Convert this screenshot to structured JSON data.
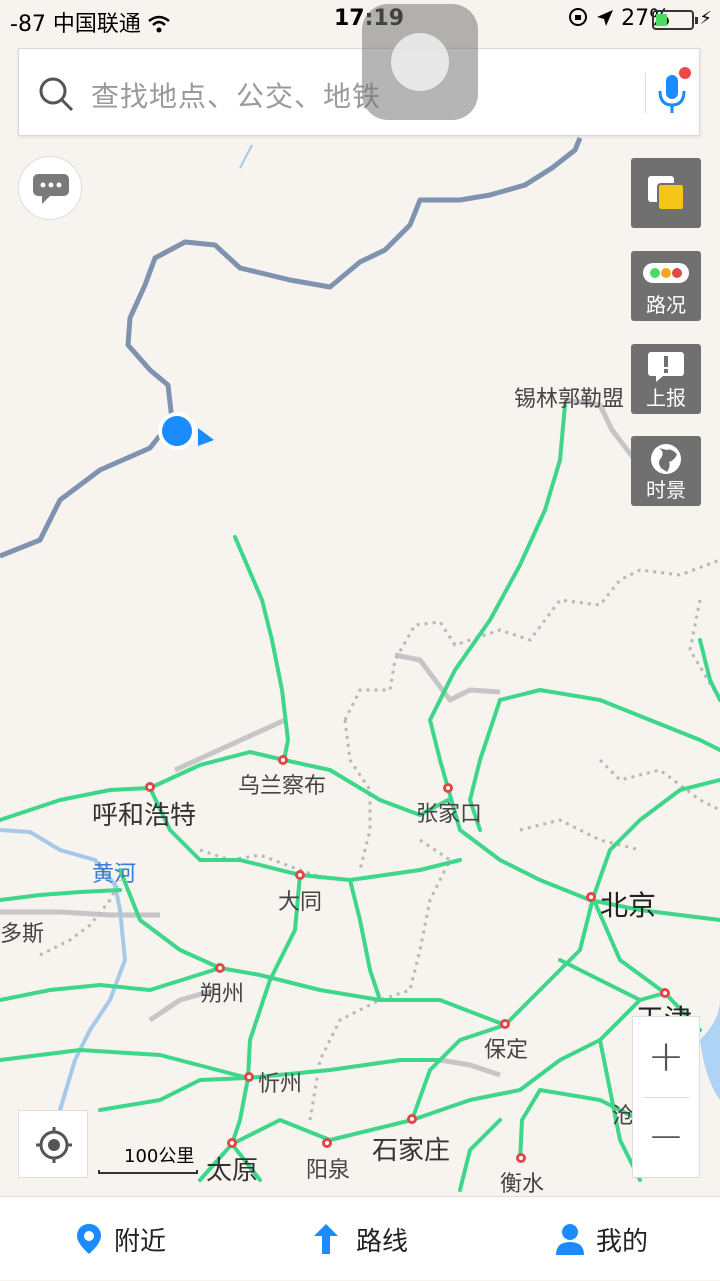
{
  "status_bar": {
    "signal": "-87 中国联通",
    "time": "17:19",
    "battery": "27%"
  },
  "search": {
    "placeholder": "查找地点、公交、地铁"
  },
  "side_buttons": {
    "layers": "",
    "traffic": "路况",
    "report": "上报",
    "streetview": "时景"
  },
  "map": {
    "cities": {
      "xilin": "锡林郭勒盟",
      "wulan": "乌兰察布",
      "hohhot": "呼和浩特",
      "zhangjiakou": "张家口",
      "yellow_river": "黄河",
      "datong": "大同",
      "beijing": "北京",
      "ordos": "多斯",
      "shuozhou": "朔州",
      "tianjin": "天津",
      "baoding": "保定",
      "xinzhou": "忻州",
      "cang": "沧",
      "taiyuan": "太原",
      "yangquan": "阳泉",
      "shijiazhuang": "石家庄",
      "hengshui": "衡水"
    },
    "scale": "100公里"
  },
  "zoom": {
    "in": "+",
    "out": "−"
  },
  "bottom_nav": {
    "nearby": "附近",
    "route": "路线",
    "mine": "我的"
  },
  "colors": {
    "highway": "#3dd68a",
    "border": "#7f93b0",
    "accent": "#1a8cff",
    "city_dot": "#e04848"
  }
}
